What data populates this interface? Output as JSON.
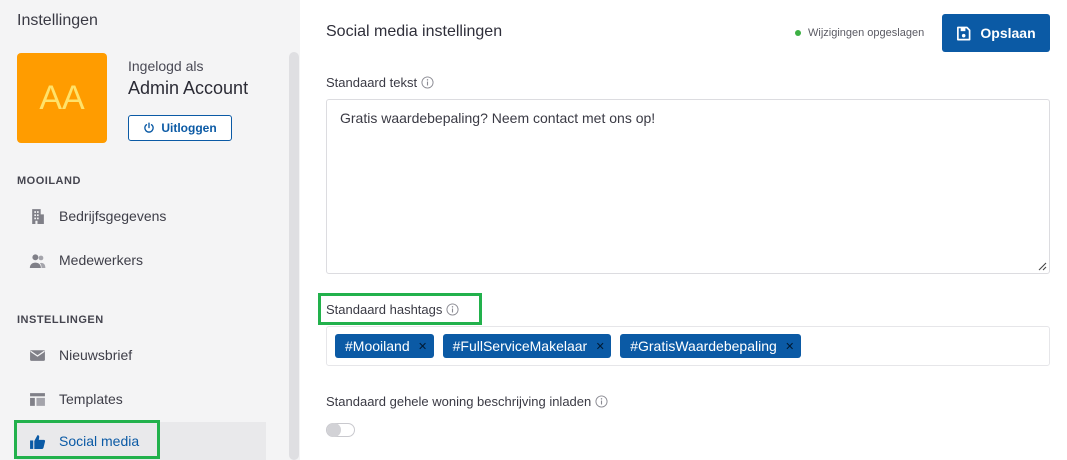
{
  "sidebar": {
    "title": "Instellingen",
    "avatar_initials": "AA",
    "logged_in_label": "Ingelogd als",
    "account_name": "Admin Account",
    "logout_label": "Uitloggen",
    "sections": [
      {
        "label": "MOOILAND",
        "items": [
          {
            "label": "Bedrijfsgegevens",
            "icon": "building-icon"
          },
          {
            "label": "Medewerkers",
            "icon": "users-icon"
          }
        ]
      },
      {
        "label": "INSTELLINGEN",
        "items": [
          {
            "label": "Nieuwsbrief",
            "icon": "envelope-icon"
          },
          {
            "label": "Templates",
            "icon": "template-icon"
          },
          {
            "label": "Social media",
            "icon": "thumbs-up-icon",
            "active": true
          }
        ]
      }
    ]
  },
  "header": {
    "title": "Social media instellingen",
    "status_text": "Wijzigingen opgeslagen",
    "save_label": "Opslaan"
  },
  "form": {
    "default_text": {
      "label": "Standaard tekst",
      "value": "Gratis waardebepaling? Neem contact met ons op!"
    },
    "default_hashtags": {
      "label": "Standaard hashtags",
      "tags": [
        "#Mooiland",
        "#FullServiceMakelaar",
        "#GratisWaardebepaling"
      ]
    },
    "load_description": {
      "label": "Standaard gehele woning beschrijving inladen",
      "enabled": false
    }
  },
  "colors": {
    "primary": "#0b5aa5",
    "avatar": "#ff9c00",
    "status_dot": "#3cb043",
    "highlight": "#22b14c"
  }
}
